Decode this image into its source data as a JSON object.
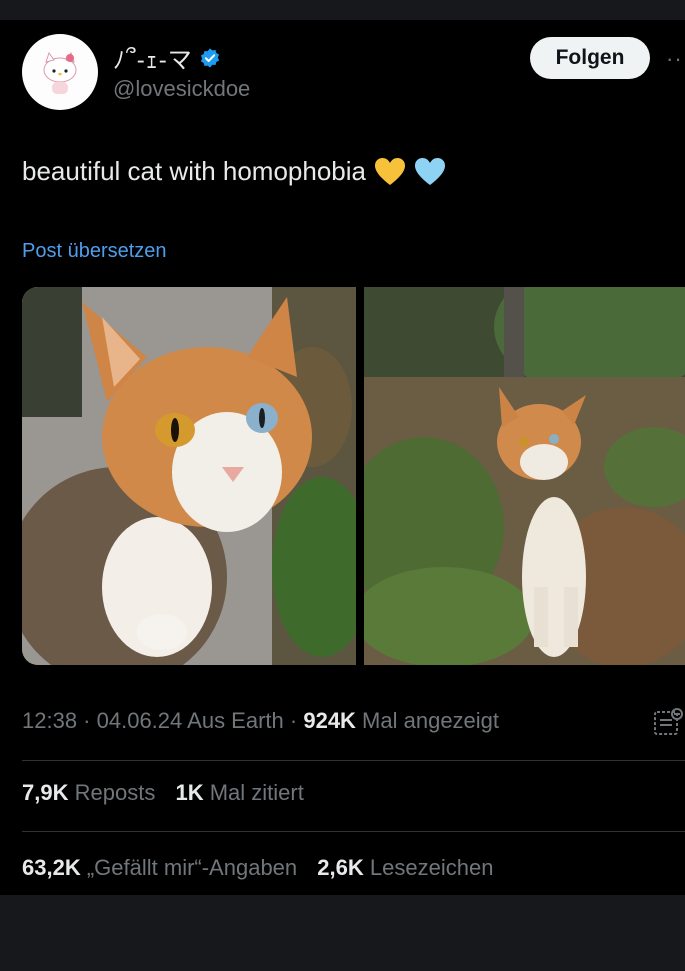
{
  "author": {
    "display_name": "ﾉ՞-ｪ-マ",
    "handle": "@lovesickdoe",
    "verified": true
  },
  "header": {
    "follow_label": "Folgen",
    "more_label": "··"
  },
  "tweet": {
    "text": "beautiful cat with homophobia",
    "emojis": [
      "yellow-heart",
      "blue-heart"
    ],
    "translate_label": "Post übersetzen"
  },
  "media": [
    {
      "name": "calico-cat-closeup"
    },
    {
      "name": "calico-cat-garden"
    }
  ],
  "meta": {
    "time": "12:38",
    "sep1": " · ",
    "date": "04.06.24",
    "location": " Aus Earth",
    "sep2": " · ",
    "views_count": "924K",
    "views_label": " Mal angezeigt"
  },
  "stats": {
    "reposts_count": "7,9K",
    "reposts_label": "Reposts",
    "quotes_count": "1K",
    "quotes_label": "Mal zitiert",
    "likes_count": "63,2K",
    "likes_label": "„Gefällt mir“-Angaben",
    "bookmarks_count": "2,6K",
    "bookmarks_label": "Lesezeichen"
  },
  "colors": {
    "background": "#000000",
    "link": "#4f9eed",
    "muted_text": "#71767b",
    "verified_badge": "#1d9bf0"
  }
}
